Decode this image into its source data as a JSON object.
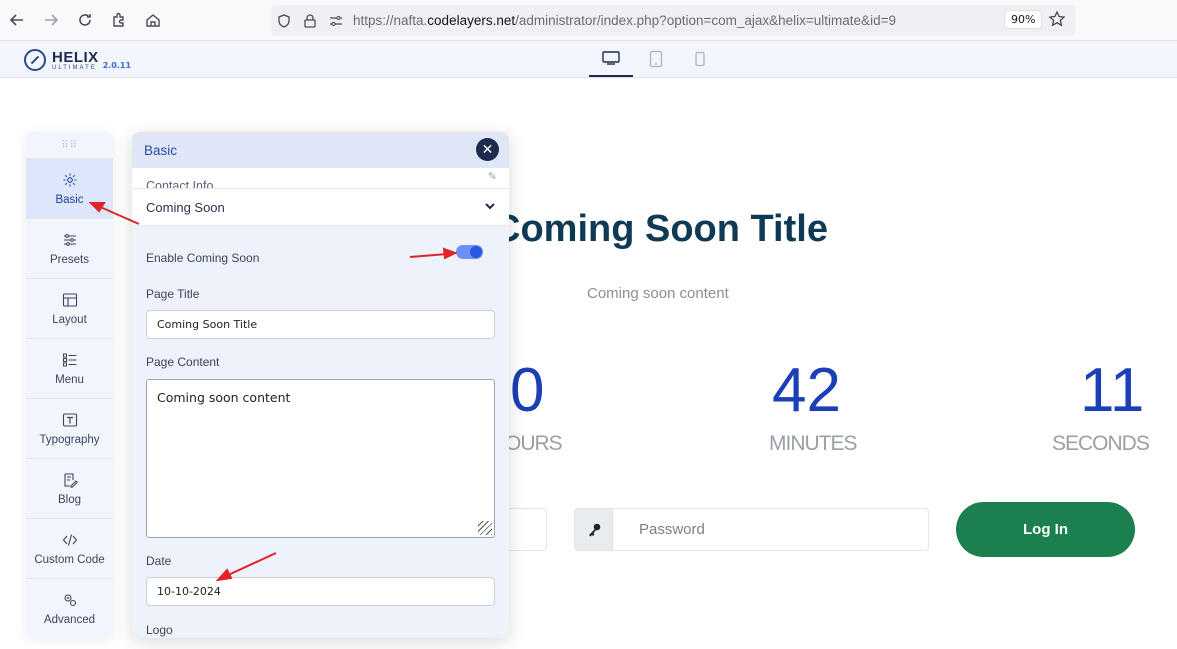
{
  "browser": {
    "url_prefix": "https://nafta.",
    "url_domain": "codelayers.net",
    "url_rest": "/administrator/index.php?option=com_ajax&helix=ultimate&id=9",
    "zoom": "90%"
  },
  "helix": {
    "brand": "HELIX",
    "brand_sub": "ULTIMATE",
    "version": "2.0.11"
  },
  "sidebar": {
    "items": [
      {
        "label": "Basic",
        "icon": "gear-icon",
        "active": true
      },
      {
        "label": "Presets",
        "icon": "sliders-icon"
      },
      {
        "label": "Layout",
        "icon": "layout-icon"
      },
      {
        "label": "Menu",
        "icon": "menu-icon"
      },
      {
        "label": "Typography",
        "icon": "typography-icon"
      },
      {
        "label": "Blog",
        "icon": "blog-icon"
      },
      {
        "label": "Custom Code",
        "icon": "code-icon"
      },
      {
        "label": "Advanced",
        "icon": "advanced-icon"
      }
    ]
  },
  "panel": {
    "title": "Basic",
    "collapsed_section": "Contact Info",
    "open_section": "Coming Soon",
    "enable_label": "Enable Coming Soon",
    "enable_value": true,
    "page_title_label": "Page Title",
    "page_title_value": "Coming Soon Title",
    "page_content_label": "Page Content",
    "page_content_value": "Coming soon content",
    "date_label": "Date",
    "date_value": "10-10-2024",
    "logo_label": "Logo"
  },
  "preview": {
    "title_visible": "Coming Soon Title",
    "content": "Coming soon content",
    "hours_num": "0",
    "hours_lbl": "OURS",
    "minutes_num": "42",
    "minutes_lbl": "MINUTES",
    "seconds_num": "11",
    "seconds_lbl": "SECONDS",
    "password_placeholder": "Password",
    "login_label": "Log In"
  }
}
